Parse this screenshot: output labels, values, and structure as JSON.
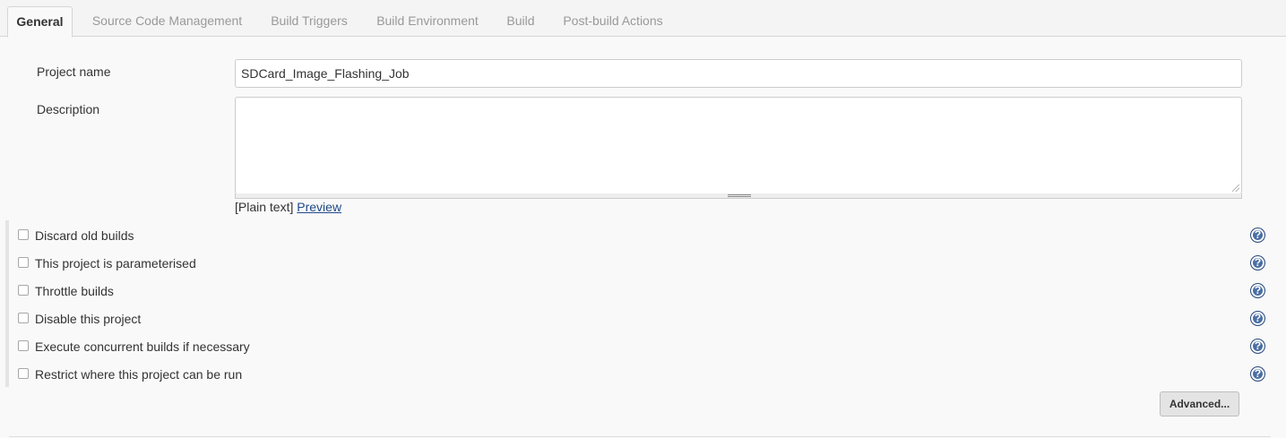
{
  "tabs": [
    {
      "label": "General",
      "active": true
    },
    {
      "label": "Source Code Management",
      "active": false
    },
    {
      "label": "Build Triggers",
      "active": false
    },
    {
      "label": "Build Environment",
      "active": false
    },
    {
      "label": "Build",
      "active": false
    },
    {
      "label": "Post-build Actions",
      "active": false
    }
  ],
  "form": {
    "project_name_label": "Project name",
    "project_name_value": "SDCard_Image_Flashing_Job",
    "description_label": "Description",
    "description_value": "",
    "format_text": "[Plain text]",
    "preview_link": "Preview"
  },
  "options": [
    {
      "label": "Discard old builds",
      "checked": false
    },
    {
      "label": "This project is parameterised",
      "checked": false
    },
    {
      "label": "Throttle builds",
      "checked": false
    },
    {
      "label": "Disable this project",
      "checked": false
    },
    {
      "label": "Execute concurrent builds if necessary",
      "checked": false
    },
    {
      "label": "Restrict where this project can be run",
      "checked": false
    }
  ],
  "help_icon_glyph": "?",
  "advanced_button": "Advanced..."
}
